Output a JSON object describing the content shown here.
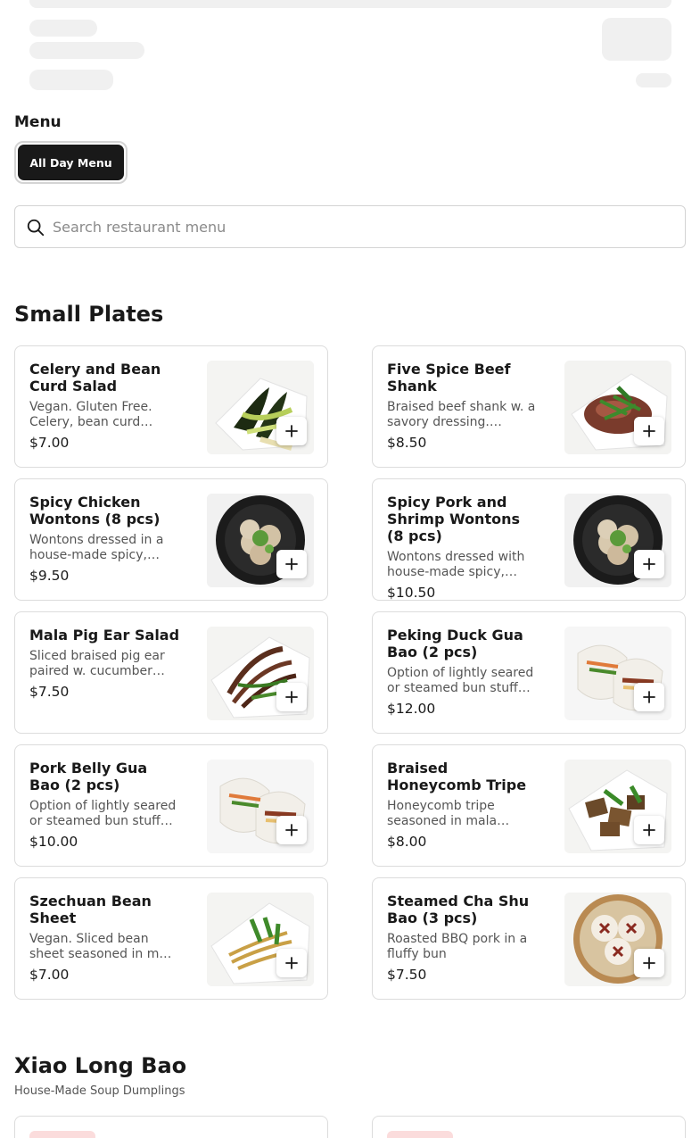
{
  "menu": {
    "heading": "Menu",
    "tab_label": "All Day Menu"
  },
  "search": {
    "placeholder": "Search restaurant menu",
    "value": ""
  },
  "sections": [
    {
      "title": "Small Plates",
      "items": [
        {
          "name": "Celery and Bean Curd Salad",
          "desc": "Vegan. Gluten Free. Celery, bean curd…",
          "price": "$7.00",
          "image": "green-salad"
        },
        {
          "name": "Five Spice Beef Shank",
          "desc": "Braised beef shank w. a savory dressing.…",
          "price": "$8.50",
          "image": "beef-shank"
        },
        {
          "name": "Spicy Chicken Wontons (8 pcs)",
          "desc": "Wontons dressed in a house-made spicy,…",
          "price": "$9.50",
          "image": "wontons-bowl"
        },
        {
          "name": "Spicy Pork and Shrimp Wontons (8 pcs)",
          "desc": "Wontons dressed with house-made spicy,…",
          "price": "$10.50",
          "image": "wontons-bowl"
        },
        {
          "name": "Mala Pig Ear Salad",
          "desc": "Sliced braised pig ear paired w. cucumber…",
          "price": "$7.50",
          "image": "pig-ear"
        },
        {
          "name": "Peking Duck Gua Bao (2 pcs)",
          "desc": "Option of lightly seared or steamed bun stuff…",
          "price": "$12.00",
          "image": "gua-bao"
        },
        {
          "name": "Pork Belly Gua Bao (2 pcs)",
          "desc": "Option of lightly seared or steamed bun stuff…",
          "price": "$10.00",
          "image": "gua-bao"
        },
        {
          "name": "Braised Honeycomb Tripe",
          "desc": "Honeycomb tripe seasoned in mala…",
          "price": "$8.00",
          "image": "tripe"
        },
        {
          "name": "Szechuan Bean Sheet",
          "desc": "Vegan. Sliced bean sheet seasoned in m…",
          "price": "$7.00",
          "image": "bean-sheet"
        },
        {
          "name": "Steamed Cha Shu Bao (3 pcs)",
          "desc": "Roasted BBQ pork in a fluffy bun",
          "price": "$7.50",
          "image": "steamed-buns"
        }
      ]
    },
    {
      "title": "Xiao Long Bao",
      "subtitle": "House-Made Soup Dumplings"
    }
  ],
  "colors": {
    "text": "#191919",
    "muted": "#555555",
    "border": "#dcdcdc",
    "tab_bg": "#191919",
    "skeleton": "#f0f0f0",
    "badge_bg": "#fbdcdc"
  }
}
